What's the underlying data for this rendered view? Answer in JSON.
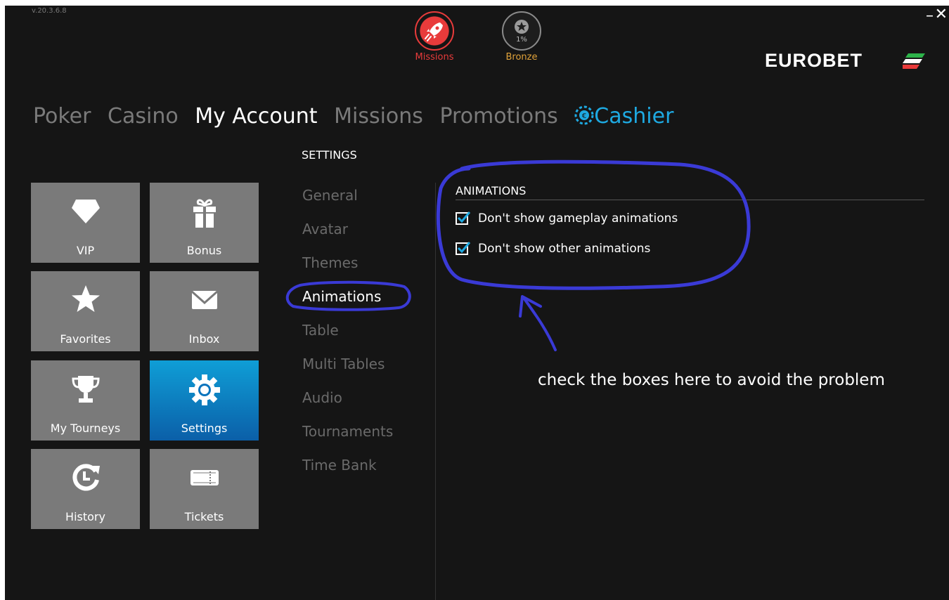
{
  "app": {
    "version": "v.20.3.6.8"
  },
  "window": {
    "minimize": "–",
    "close": "✕"
  },
  "badges": {
    "missions": {
      "label": "Missions",
      "icon": "rocket-icon",
      "color": "#e83b3b"
    },
    "bronze": {
      "label": "Bronze",
      "percent": "1%",
      "icon": "star-icon",
      "color": "#e0a23a"
    }
  },
  "brand": {
    "name": "EUROBET"
  },
  "topnav": {
    "poker": "Poker",
    "casino": "Casino",
    "my_account": "My Account",
    "missions": "Missions",
    "promotions": "Promotions",
    "cashier": "Cashier",
    "cashier_icon": "euro-chip-icon",
    "accent": "#1ea9e1"
  },
  "tiles": [
    {
      "label": "VIP",
      "icon": "diamond-icon"
    },
    {
      "label": "Bonus",
      "icon": "gift-icon"
    },
    {
      "label": "Favorites",
      "icon": "star-icon"
    },
    {
      "label": "Inbox",
      "icon": "envelope-icon"
    },
    {
      "label": "My Tourneys",
      "icon": "trophy-icon"
    },
    {
      "label": "Settings",
      "icon": "gear-icon",
      "active": true
    },
    {
      "label": "History",
      "icon": "history-icon"
    },
    {
      "label": "Tickets",
      "icon": "ticket-icon"
    }
  ],
  "settings": {
    "heading": "SETTINGS",
    "menu": [
      "General",
      "Avatar",
      "Themes",
      "Animations",
      "Table",
      "Multi Tables",
      "Audio",
      "Tournaments",
      "Time Bank"
    ],
    "active": "Animations"
  },
  "animations": {
    "heading": "ANIMATIONS",
    "options": [
      {
        "label": "Don't show gameplay animations",
        "checked": true
      },
      {
        "label": "Don't show other animations",
        "checked": true
      }
    ]
  },
  "annotation": {
    "text": "check the boxes here to avoid the problem",
    "color": "#3a3ad6"
  }
}
